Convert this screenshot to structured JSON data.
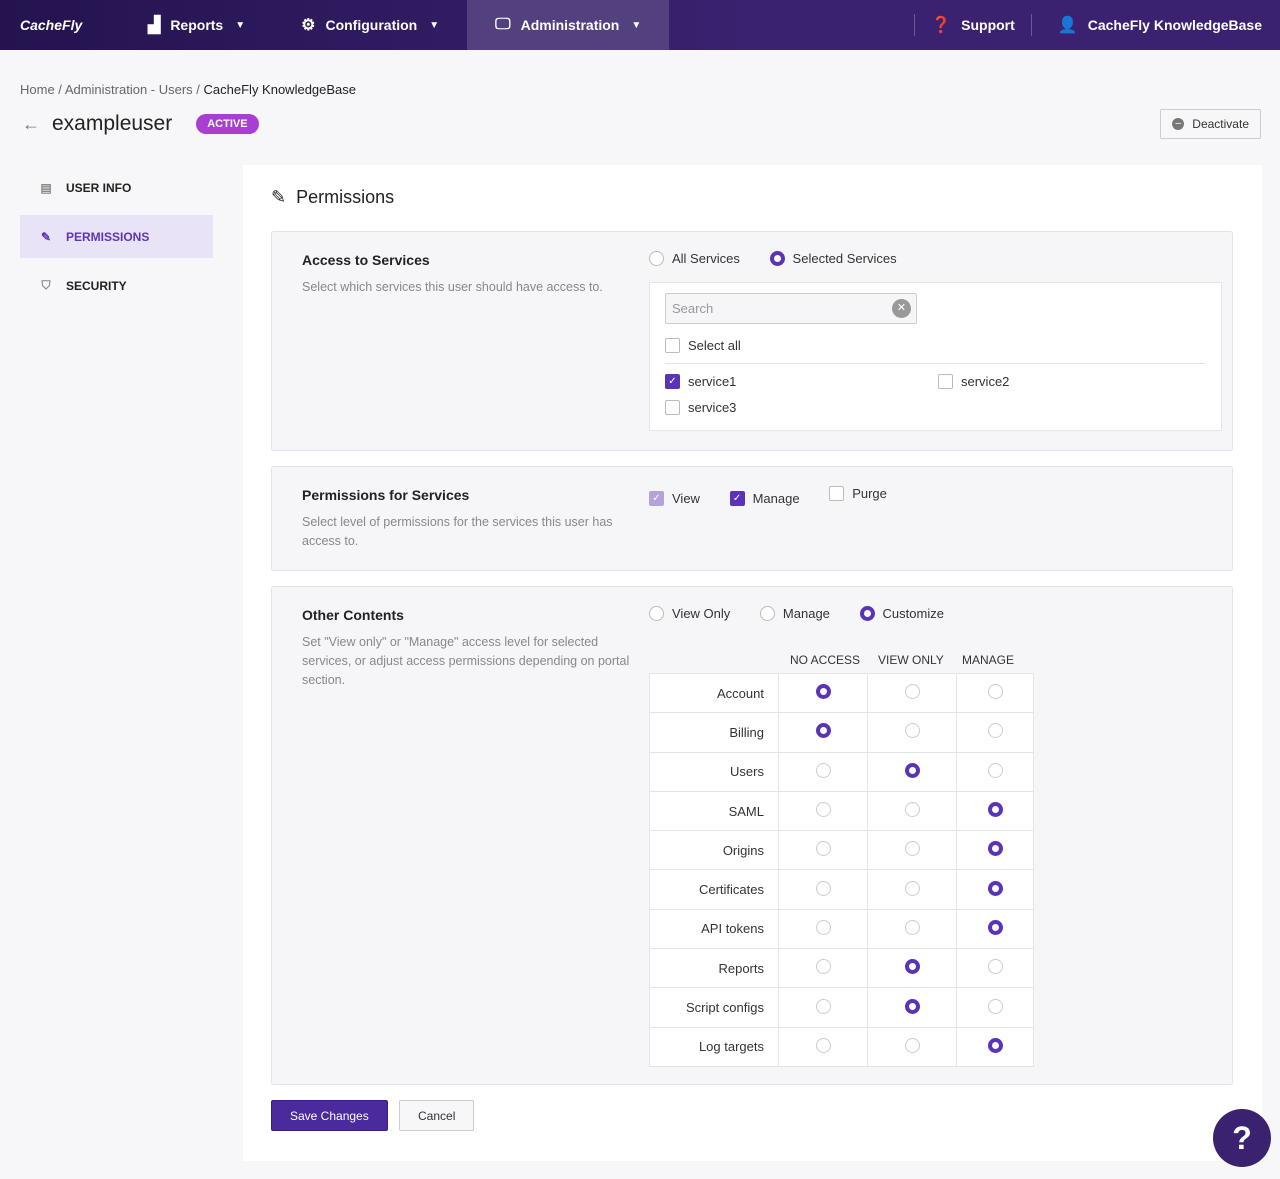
{
  "nav": {
    "logo": "CacheFly",
    "items": [
      {
        "label": "Reports",
        "icon": "chart-icon"
      },
      {
        "label": "Configuration",
        "icon": "gear-icon"
      },
      {
        "label": "Administration",
        "icon": "monitor-icon"
      }
    ],
    "support": "Support",
    "account": "CacheFly KnowledgeBase"
  },
  "breadcrumb": [
    "Home",
    "Administration - Users",
    "CacheFly KnowledgeBase"
  ],
  "user": {
    "name": "exampleuser",
    "status": "ACTIVE"
  },
  "deactivate": "Deactivate",
  "sidebar": [
    {
      "label": "USER INFO",
      "active": false
    },
    {
      "label": "PERMISSIONS",
      "active": true
    },
    {
      "label": "SECURITY",
      "active": false
    }
  ],
  "card_title": "Permissions",
  "access": {
    "title": "Access to Services",
    "desc": "Select which services this user should have access to.",
    "options": [
      "All Services",
      "Selected Services"
    ],
    "selected": 1,
    "search_placeholder": "Search",
    "select_all": "Select all",
    "services": [
      {
        "name": "service1",
        "checked": true
      },
      {
        "name": "service2",
        "checked": false
      },
      {
        "name": "service3",
        "checked": false
      }
    ]
  },
  "perm_services": {
    "title": "Permissions for Services",
    "desc": "Select level of permissions for the services this user has access to.",
    "options": [
      {
        "label": "View",
        "checked": true
      },
      {
        "label": "Manage",
        "checked": true
      },
      {
        "label": "Purge",
        "checked": false
      }
    ]
  },
  "other": {
    "title": "Other Contents",
    "desc": "Set \"View only\" or \"Manage\" access level for selected services, or adjust access permissions depending on portal section.",
    "options": [
      "View Only",
      "Manage",
      "Customize"
    ],
    "selected": 2,
    "columns": [
      "NO ACCESS",
      "VIEW ONLY",
      "MANAGE"
    ],
    "rows": [
      {
        "label": "Account",
        "level": 0
      },
      {
        "label": "Billing",
        "level": 0
      },
      {
        "label": "Users",
        "level": 1
      },
      {
        "label": "SAML",
        "level": 2
      },
      {
        "label": "Origins",
        "level": 2
      },
      {
        "label": "Certificates",
        "level": 2
      },
      {
        "label": "API tokens",
        "level": 2
      },
      {
        "label": "Reports",
        "level": 1
      },
      {
        "label": "Script configs",
        "level": 1
      },
      {
        "label": "Log targets",
        "level": 2
      }
    ]
  },
  "buttons": {
    "save": "Save Changes",
    "cancel": "Cancel"
  },
  "accent": "#5a34b6"
}
